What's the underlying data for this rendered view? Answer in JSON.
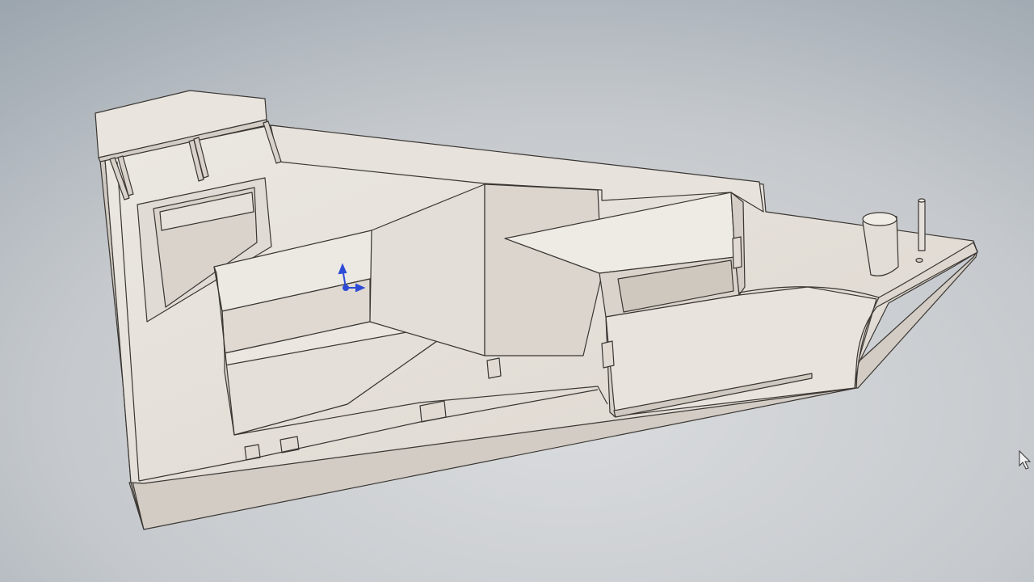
{
  "viewport": {
    "background_colors": [
      "#a9b2ba",
      "#c8ccd0",
      "#d6d8da"
    ],
    "model_color": "#e6e1da",
    "model_shadow_color": "#c9c3bb",
    "edge_color": "#3a3632"
  },
  "triad": {
    "axis_color": "#2d4bd6",
    "icon": "coordinate-triad-icon"
  },
  "cursor": {
    "icon": "mouse-pointer-icon",
    "color": "#f2f2f2"
  }
}
